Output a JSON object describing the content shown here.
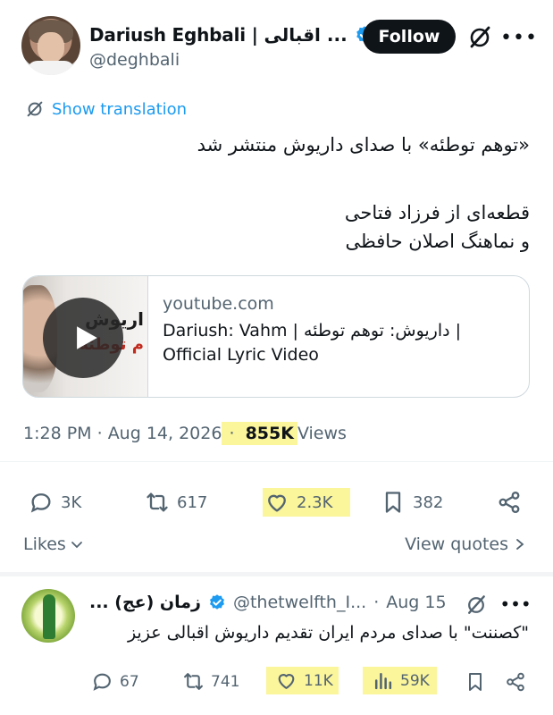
{
  "author": {
    "name": "Dariush Eghbali | اقبالی ...",
    "handle": "@deghbali",
    "follow_label": "Follow"
  },
  "translation_link": "Show translation",
  "tweet_lines": [
    "«توهم توطئه» با صدای داریوش منتشر شد",
    "",
    "قطعه‌ای از فرزاد فتاحی",
    "و نماهنگ اصلان حافظی"
  ],
  "card": {
    "thumb_text_1": "اریوش",
    "thumb_text_2": "م توطئه",
    "domain": "youtube.com",
    "title_line1": "Dariush: Vahm | داریوش: توهم توطئه |",
    "title_line2": "Official Lyric Video"
  },
  "meta": {
    "time": "1:28 PM",
    "sep": " · ",
    "date": "Aug 14, 2026",
    "views_count": "855K",
    "views_label": "Views"
  },
  "actions": {
    "replies": "3K",
    "reposts": "617",
    "likes": "2.3K",
    "bookmarks": "382"
  },
  "likes_link": "Likes",
  "quotes_link": "View quotes",
  "reply": {
    "name": "زمان (عج) ...",
    "handle": "@thetwelfth_I...",
    "dot": "·",
    "date": "Aug 15",
    "text": "\"کصننت\" با صدای مردم ایران تقدیم داریوش اقبالی عزیز",
    "replies": "67",
    "reposts": "741",
    "likes": "11K",
    "views": "59K"
  },
  "colors": {
    "accent": "#1d9bf0",
    "text": "#0f1419",
    "muted": "#536471",
    "highlight": "#fbf59b"
  },
  "icons": [
    "verified-badge-icon",
    "grok-icon",
    "more-icon",
    "translate-icon",
    "play-icon",
    "reply-icon",
    "repost-icon",
    "like-icon",
    "bookmark-icon",
    "share-icon",
    "views-icon",
    "chevron-down-icon",
    "chevron-right-icon"
  ]
}
